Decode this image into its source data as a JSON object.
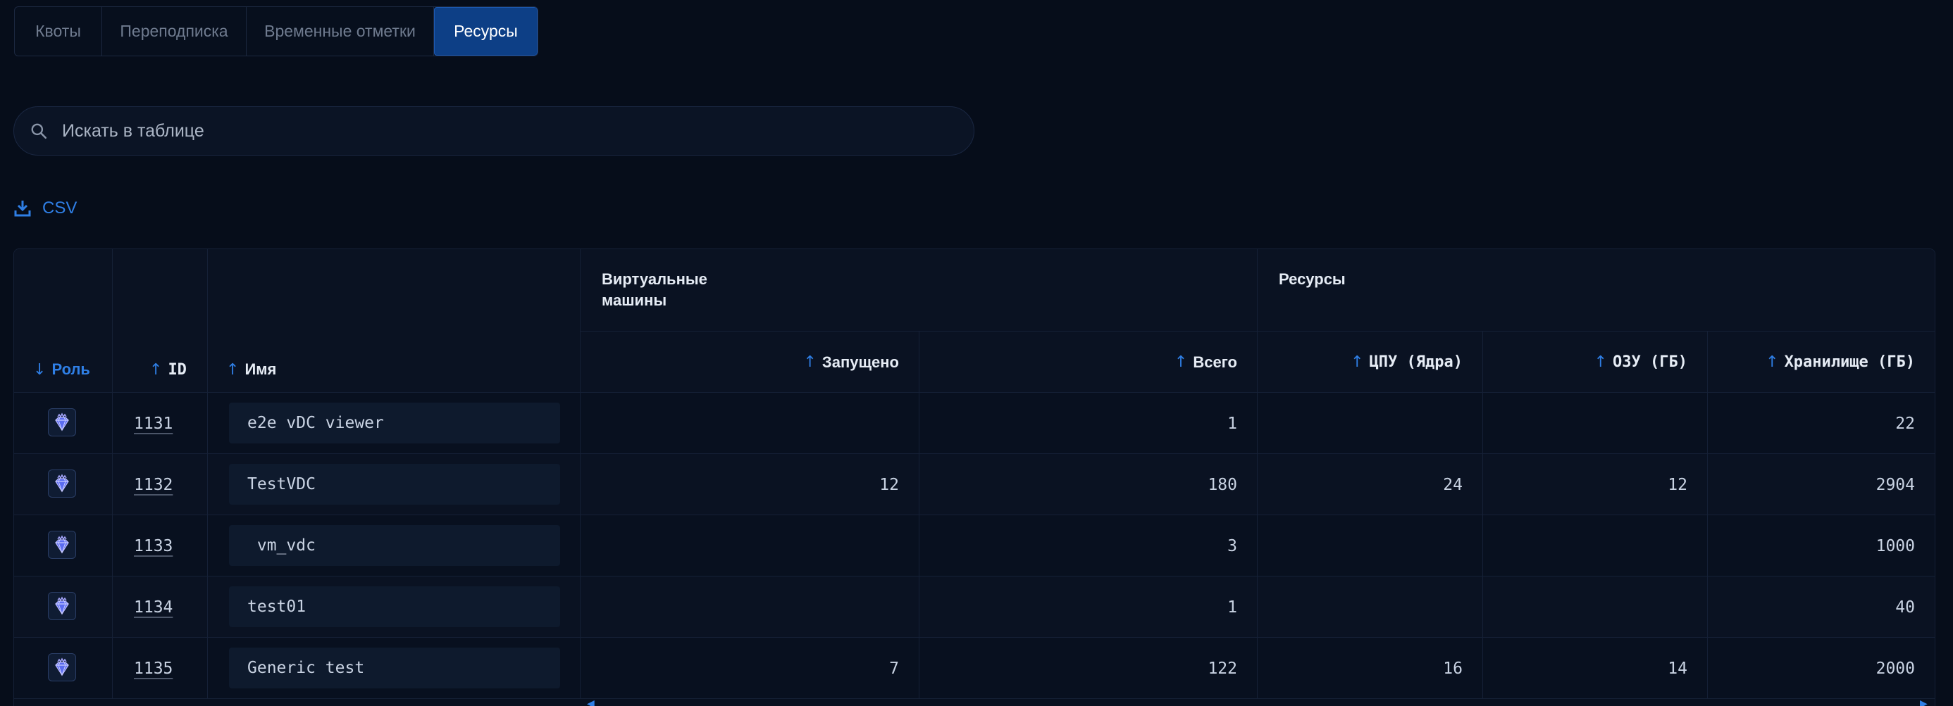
{
  "tabs": [
    {
      "label": "Квоты",
      "active": false
    },
    {
      "label": "Переподписка",
      "active": false
    },
    {
      "label": "Временные отметки",
      "active": false
    },
    {
      "label": "Ресурсы",
      "active": true
    }
  ],
  "search": {
    "placeholder": "Искать в таблице",
    "value": ""
  },
  "export": {
    "label": "CSV",
    "icon": "download-icon"
  },
  "table": {
    "groups": {
      "vm": "Виртуальные\nмашины",
      "resources": "Ресурсы"
    },
    "columns": {
      "role": "Роль",
      "id": "ID",
      "name": "Имя",
      "running": "Запущено",
      "total": "Всего",
      "cpu": "ЦПУ (Ядра)",
      "ram": "ОЗУ (ГБ)",
      "storage": "Хранилище (ГБ)"
    },
    "sort": {
      "role": "desc",
      "others": "asc"
    },
    "rows": [
      {
        "role_icon": "diamond-crown-icon",
        "id": "1131",
        "name": "e2e vDC viewer",
        "running": "",
        "total": "1",
        "cpu": "",
        "ram": "",
        "storage": "22"
      },
      {
        "role_icon": "diamond-crown-icon",
        "id": "1132",
        "name": "TestVDC",
        "running": "12",
        "total": "180",
        "cpu": "24",
        "ram": "12",
        "storage": "2904"
      },
      {
        "role_icon": "diamond-crown-icon",
        "id": "1133",
        "name": " vm_vdc",
        "running": "",
        "total": "3",
        "cpu": "",
        "ram": "",
        "storage": "1000"
      },
      {
        "role_icon": "diamond-crown-icon",
        "id": "1134",
        "name": "test01",
        "running": "",
        "total": "1",
        "cpu": "",
        "ram": "",
        "storage": "40"
      },
      {
        "role_icon": "diamond-crown-icon",
        "id": "1135",
        "name": "Generic test",
        "running": "7",
        "total": "122",
        "cpu": "16",
        "ram": "14",
        "storage": "2000"
      }
    ]
  },
  "colors": {
    "accent": "#2f7fe6",
    "active_tab": "#0d3f86",
    "background": "#060d1a"
  }
}
